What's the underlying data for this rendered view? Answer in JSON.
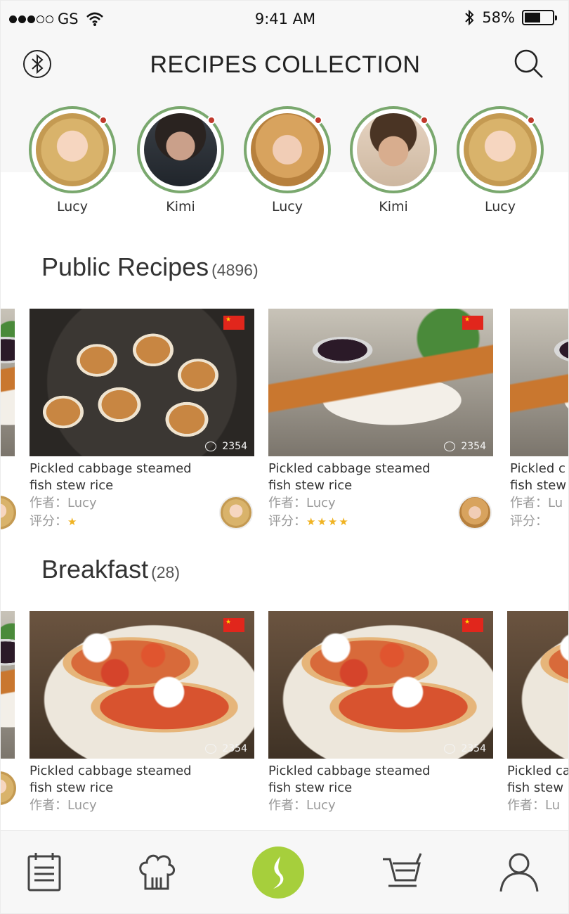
{
  "status_bar": {
    "carrier": "GS",
    "time": "9:41 AM",
    "battery": "58%",
    "signal_bars_filled": 3,
    "signal_bars_total": 5,
    "battery_level": 0.58
  },
  "header": {
    "title": "RECIPES COLLECTION",
    "left_icon": "bluetooth-icon",
    "right_icon": "search-icon"
  },
  "stories": [
    {
      "name": "Lucy"
    },
    {
      "name": "Kimi"
    },
    {
      "name": "Lucy"
    },
    {
      "name": "Kimi"
    },
    {
      "name": "Lucy"
    }
  ],
  "sections": [
    {
      "title": "Public Recipes",
      "count": "(4896)",
      "cards": [
        {
          "line1": "Pickled cabbage steamed",
          "line2": "fish stew rice",
          "author": "作者：Lucy",
          "rating_label": "评分：",
          "stars": "★",
          "comments": "2354"
        },
        {
          "line1": "Pickled cabbage steamed",
          "line2": "fish stew rice",
          "author": "作者：Lucy",
          "rating_label": "评分：",
          "stars": "★★★★",
          "comments": "2354"
        },
        {
          "line1": "Pickled c",
          "line2": "fish stew",
          "author": "作者：Lu",
          "rating_label": "评分：",
          "stars": "",
          "comments": ""
        }
      ]
    },
    {
      "title": "Breakfast",
      "count": "(28)",
      "cards": [
        {
          "line1": "Pickled cabbage steamed",
          "line2": "fish stew rice",
          "author": "作者：Lucy",
          "comments": "2354"
        },
        {
          "line1": "Pickled cabbage steamed",
          "line2": "fish stew rice",
          "author": "作者：Lucy",
          "comments": "2354"
        },
        {
          "line1": "Pickled ca",
          "line2": "fish stew",
          "author": "作者：Lu",
          "comments": ""
        }
      ]
    }
  ],
  "tabbar": {
    "items": [
      "calendar-icon",
      "chef-hat-icon",
      "leaf-icon",
      "cart-icon",
      "user-icon"
    ],
    "accent": "#a6cf3c"
  },
  "colors": {
    "ring": "#7aa86e",
    "badge": "#c0392b",
    "star": "#f0b323"
  }
}
